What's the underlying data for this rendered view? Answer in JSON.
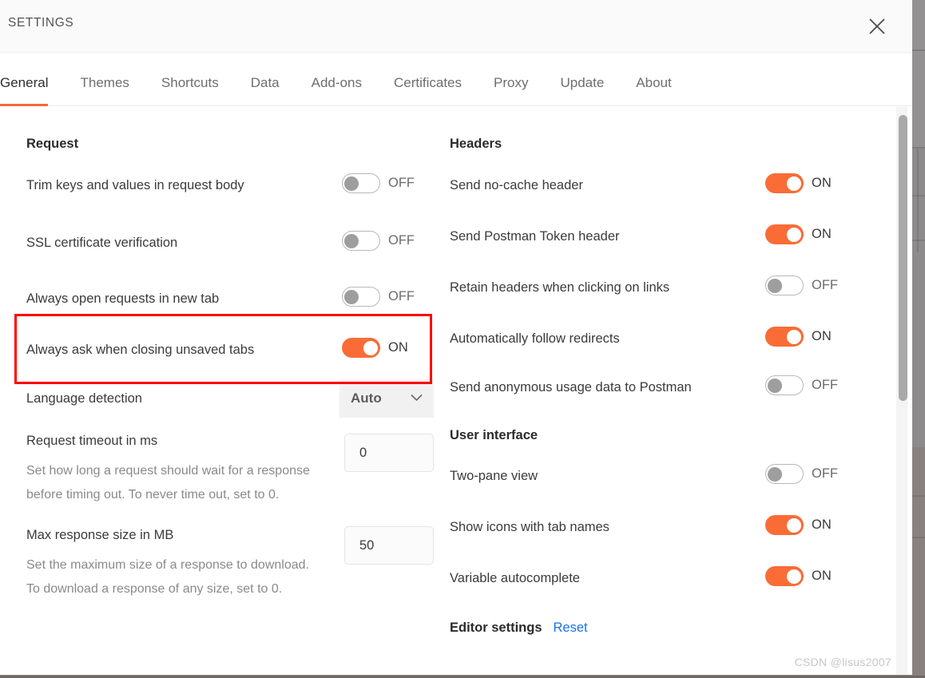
{
  "modal": {
    "title": "SETTINGS",
    "close_icon": "close-icon"
  },
  "tabs": [
    {
      "label": "General",
      "active": true
    },
    {
      "label": "Themes",
      "active": false
    },
    {
      "label": "Shortcuts",
      "active": false
    },
    {
      "label": "Data",
      "active": false
    },
    {
      "label": "Add-ons",
      "active": false
    },
    {
      "label": "Certificates",
      "active": false
    },
    {
      "label": "Proxy",
      "active": false
    },
    {
      "label": "Update",
      "active": false
    },
    {
      "label": "About",
      "active": false
    }
  ],
  "left_column": {
    "section_title": "Request",
    "rows": {
      "trim_keys": {
        "label": "Trim keys and values in request body",
        "state": "OFF"
      },
      "ssl_verification": {
        "label": "SSL certificate verification",
        "state": "OFF"
      },
      "open_new_tab": {
        "label": "Always open requests in new tab",
        "state": "OFF"
      },
      "ask_closing": {
        "label": "Always ask when closing unsaved tabs",
        "state": "ON"
      },
      "language_detection": {
        "label": "Language detection",
        "value": "Auto",
        "chevron": "chevron-down-icon"
      },
      "request_timeout": {
        "label": "Request timeout in ms",
        "value": "0",
        "description": "Set how long a request should wait for a response before timing out. To never time out, set to 0."
      },
      "max_response_size": {
        "label": "Max response size in MB",
        "value": "50",
        "description": "Set the maximum size of a response to download. To download a response of any size, set to 0."
      }
    }
  },
  "right_column": {
    "headers_section_title": "Headers",
    "headers_rows": {
      "no_cache": {
        "label": "Send no-cache header",
        "state": "ON"
      },
      "postman_token": {
        "label": "Send Postman Token header",
        "state": "ON"
      },
      "retain_headers": {
        "label": "Retain headers when clicking on links",
        "state": "OFF"
      },
      "follow_redirects": {
        "label": "Automatically follow redirects",
        "state": "ON"
      },
      "usage_data": {
        "label": "Send anonymous usage data to Postman",
        "state": "OFF"
      }
    },
    "ui_section_title": "User interface",
    "ui_rows": {
      "two_pane": {
        "label": "Two-pane view",
        "state": "OFF"
      },
      "show_icons": {
        "label": "Show icons with tab names",
        "state": "ON"
      },
      "variable_autocomplete": {
        "label": "Variable autocomplete",
        "state": "ON"
      }
    },
    "editor_section_title": "Editor settings",
    "editor_reset_label": "Reset"
  },
  "annotation": {
    "highlight_target": "SSL certificate verification",
    "color": "#ff0000"
  },
  "watermark": "CSDN @lisus2007",
  "colors": {
    "accent_orange": "#f96c36",
    "tab_underline": "#f26b3a",
    "link_blue": "#1a73e8",
    "toggle_off_border": "#b8b8b8"
  }
}
